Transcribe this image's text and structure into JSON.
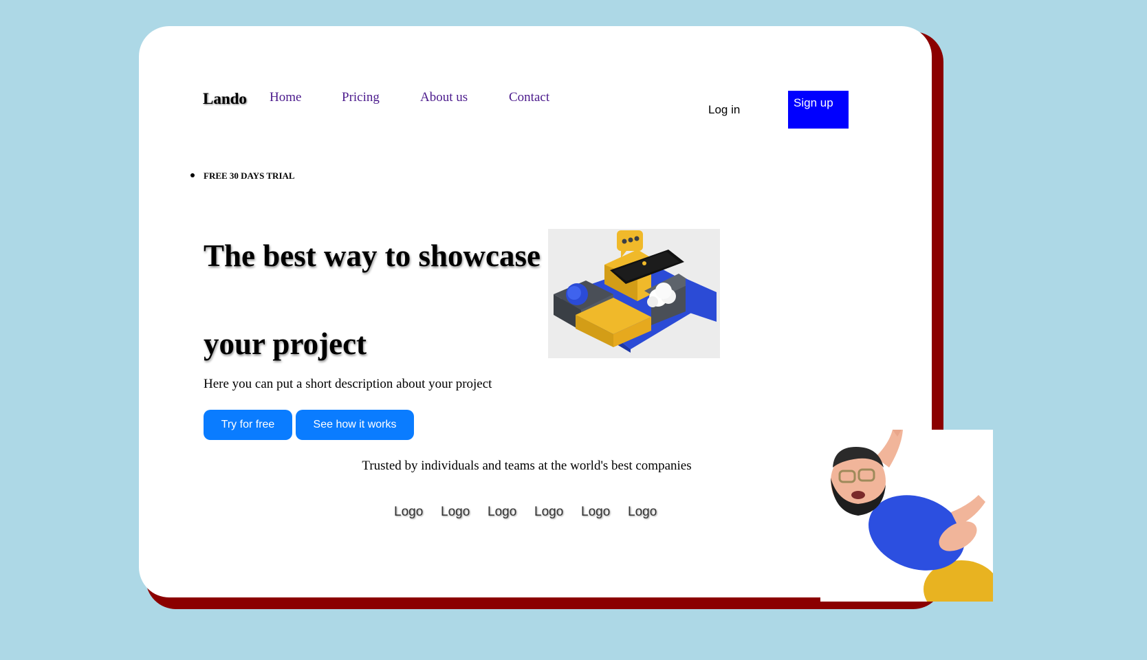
{
  "nav": {
    "brand": "Lando",
    "links": [
      "Home",
      "Pricing",
      "About us",
      "Contact"
    ],
    "login_label": "Log in",
    "signup_label": "Sign up"
  },
  "hero": {
    "badge": "FREE 30 DAYS TRIAL",
    "headline_line1": "The best way to showcase",
    "headline_line2": "your project",
    "description": "Here you can put a short description about your project",
    "primary_button": "Try for free",
    "secondary_button": "See how it works"
  },
  "trusted": {
    "text": "Trusted by individuals and teams at the world's best companies",
    "logos": [
      "Logo",
      "Logo",
      "Logo",
      "Logo",
      "Logo",
      "Logo"
    ]
  },
  "colors": {
    "background": "#add8e6",
    "card_shadow": "#8b0000",
    "signup": "#0000ff",
    "cta": "#0a7cff",
    "nav_link": "#4b1a8c"
  },
  "images": {
    "hero_illustration": "isometric-phone-blocks-illustration",
    "mascot": "waving-bearded-man-3d-character"
  }
}
